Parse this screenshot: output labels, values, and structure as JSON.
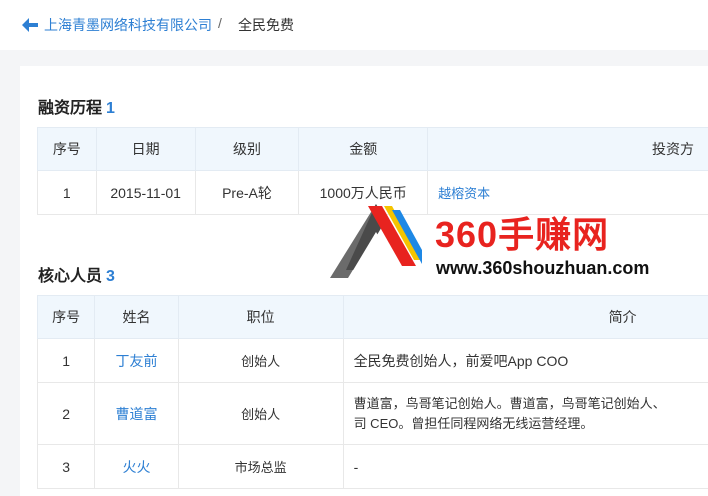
{
  "breadcrumb": {
    "company": "上海青墨网络科技有限公司",
    "separator": "/",
    "current": "全民免费"
  },
  "financing": {
    "title": "融资历程",
    "count": "1",
    "headers": [
      "序号",
      "日期",
      "级别",
      "金额",
      "投资方"
    ],
    "rows": [
      {
        "no": "1",
        "date": "2015-11-01",
        "round": "Pre-A轮",
        "amount": "1000万人民币",
        "investor": "越榕资本"
      }
    ]
  },
  "team": {
    "title": "核心人员",
    "count": "3",
    "headers": [
      "序号",
      "姓名",
      "职位",
      "简介"
    ],
    "rows": [
      {
        "no": "1",
        "name": "丁友前",
        "position": "创始人",
        "intro": "全民免费创始人，前爱吧App COO"
      },
      {
        "no": "2",
        "name": "曹道富",
        "position": "创始人",
        "intro_line1": "曹道富，鸟哥笔记创始人。曹道富，鸟哥笔记创始人、",
        "intro_line2": "司 CEO。曾担任同程网络无线运营经理。"
      },
      {
        "no": "3",
        "name": "火火",
        "position": "市场总监",
        "intro": "-"
      }
    ]
  },
  "watermark": {
    "title": "360手赚网",
    "url": "www.360shouzhuan.com"
  },
  "colors": {
    "accent": "#2d7fd3",
    "header_bg": "#f0f7fd",
    "watermark_red": "#e8231f"
  }
}
